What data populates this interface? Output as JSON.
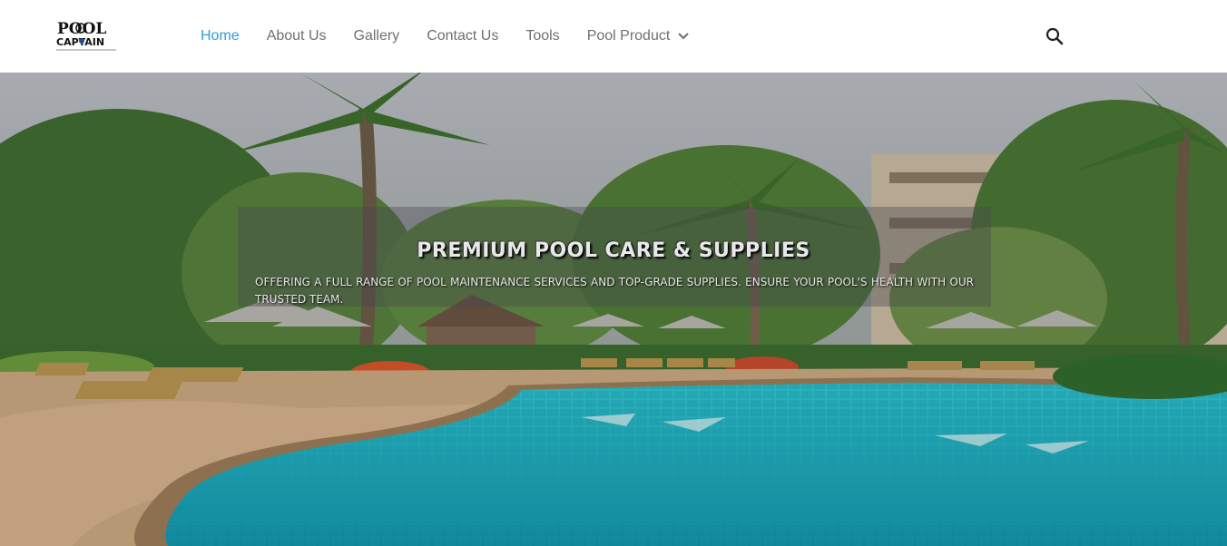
{
  "brand": {
    "logo_line1": "POOL",
    "logo_line2": "CAPTAIN",
    "logo_icon": "ship-wheel-icon"
  },
  "nav": {
    "items": [
      {
        "label": "Home",
        "active": true
      },
      {
        "label": "About Us",
        "active": false
      },
      {
        "label": "Gallery",
        "active": false
      },
      {
        "label": "Contact Us",
        "active": false
      },
      {
        "label": "Tools",
        "active": false
      },
      {
        "label": "Pool Product",
        "active": false,
        "has_dropdown": true
      }
    ],
    "dropdown_icon": "chevron-down-icon",
    "search_icon": "search-icon"
  },
  "hero": {
    "title": "PREMIUM POOL CARE & SUPPLIES",
    "subtitle": "OFFERING A FULL RANGE OF POOL MAINTENANCE SERVICES AND TOP-GRADE SUPPLIES. ENSURE YOUR POOL'S HEALTH WITH OUR TRUSTED TEAM."
  },
  "colors": {
    "accent": "#2f9ae0",
    "nav_text": "#6f6f6f",
    "header_bg": "#ffffff",
    "pool_water": "#1fb8c9"
  }
}
